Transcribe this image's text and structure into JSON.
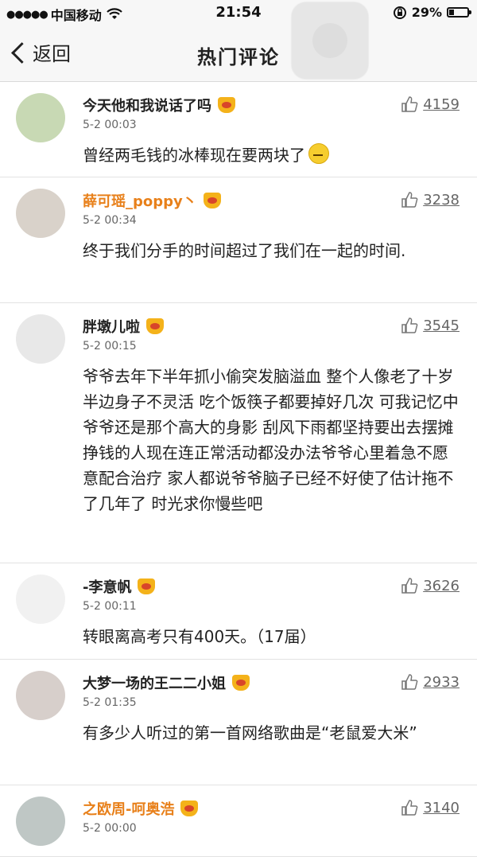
{
  "status": {
    "signal_dots": "●●●●●",
    "carrier": "中国移动",
    "wifi_icon": "wifi-icon",
    "time": "21:54",
    "battery_text": "29%",
    "battery_level": 0.29
  },
  "nav": {
    "back_label": "返回",
    "title": "热门评论"
  },
  "comments": [
    {
      "username": "今天他和我说话了吗",
      "name_color": "#222222",
      "date": "5-2 00:03",
      "likes": "4159",
      "text": "曾经两毛钱的冰棒现在要两块了",
      "height": 120
    },
    {
      "username": "薛可瑶_poppy丶",
      "name_color": "#e8801a",
      "date": "5-2 00:34",
      "likes": "3238",
      "text": "终于我们分手的时间超过了我们在一起的时间.",
      "height": 158
    },
    {
      "username": "胖墩儿啦",
      "name_color": "#222222",
      "date": "5-2 00:15",
      "likes": "3545",
      "text": "爷爷去年下半年抓小偷突发脑溢血 整个人像老了十岁 半边身子不灵活 吃个饭筷子都要掉好几次 可我记忆中爷爷还是那个高大的身影 刮风下雨都坚持要出去摆摊挣钱的人现在连正常活动都没办法爷爷心里着急不愿意配合治疗 家人都说爷爷脑子已经不好使了估计拖不了几年了 时光求你慢些吧",
      "height": 327
    },
    {
      "username": "-李意帆",
      "name_color": "#222222",
      "date": "5-2 00:11",
      "likes": "3626",
      "text": "转眼离高考只有400天。（17届）",
      "height": 121
    },
    {
      "username": "大梦一场的王二二小姐",
      "name_color": "#222222",
      "date": "5-2 01:35",
      "likes": "2933",
      "text": "有多少人听过的第一首网络歌曲是“老鼠爱大米”",
      "height": 158
    },
    {
      "username": "之欧周-呵奥浩",
      "name_color": "#e8801a",
      "date": "5-2 00:00",
      "likes": "3140",
      "text": "",
      "height": 90
    }
  ]
}
